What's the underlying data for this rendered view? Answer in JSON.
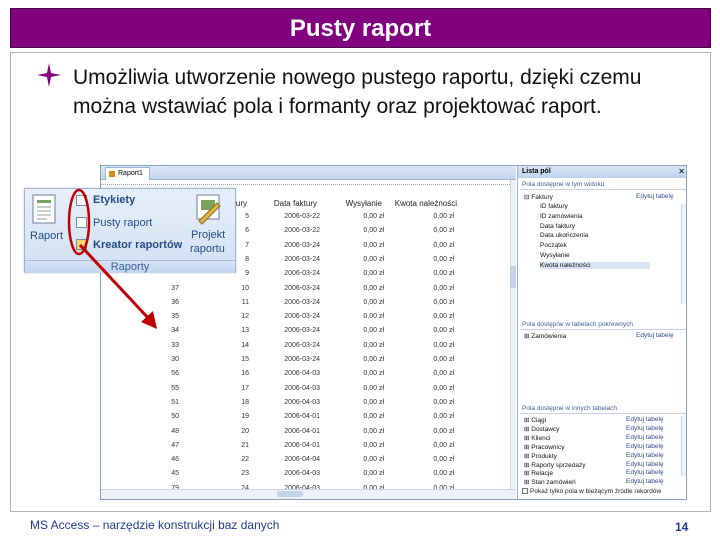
{
  "slide": {
    "title": "Pusty raport",
    "bullet": "Umożliwia utworzenie nowego pustego raportu, dzięki czemu można wstawiać pola i formanty oraz projektować raport.",
    "footer": "MS Access – narzędzie konstrukcji baz danych",
    "page_number": "14",
    "colors": {
      "title_bg": "#800080",
      "bullet_star": "#800080",
      "arrow": "#c00000",
      "footer_text": "#1f3a93"
    }
  },
  "report_view": {
    "tab_label": "Raport1",
    "columns": [
      {
        "key": "c1",
        "label": ""
      },
      {
        "key": "c2",
        "label": "ury"
      },
      {
        "key": "data_faktury",
        "label": "Data faktury"
      },
      {
        "key": "wysylanie",
        "label": "Wysyłanie"
      },
      {
        "key": "kwota",
        "label": "Kwota należności"
      }
    ],
    "rows": [
      [
        "",
        "5",
        "2006-03-22",
        "0,00 zł",
        "0,00 zł"
      ],
      [
        "",
        "6",
        "2006-03-22",
        "0,00 zł",
        "0,00 zł"
      ],
      [
        "",
        "7",
        "2006-03-24",
        "0,00 zł",
        "0,00 zł"
      ],
      [
        "",
        "8",
        "2006-03-24",
        "0,00 zł",
        "0,00 zł"
      ],
      [
        "",
        "9",
        "2006-03-24",
        "0,00 zł",
        "0,00 zł"
      ],
      [
        "37",
        "10",
        "2006-03-24",
        "0,00 zł",
        "0,00 zł"
      ],
      [
        "36",
        "11",
        "2006-03-24",
        "0,00 zł",
        "0,00 zł"
      ],
      [
        "35",
        "12",
        "2006-03-24",
        "0,00 zł",
        "0,00 zł"
      ],
      [
        "34",
        "13",
        "2006-03-24",
        "0,00 zł",
        "0,00 zł"
      ],
      [
        "33",
        "14",
        "2006-03-24",
        "0,00 zł",
        "0,00 zł"
      ],
      [
        "30",
        "15",
        "2006-03-24",
        "0,00 zł",
        "0,00 zł"
      ],
      [
        "56",
        "16",
        "2006-04-03",
        "0,00 zł",
        "0,00 zł"
      ],
      [
        "55",
        "17",
        "2006-04-03",
        "0,00 zł",
        "0,00 zł"
      ],
      [
        "51",
        "18",
        "2006-04-03",
        "0,00 zł",
        "0,00 zł"
      ],
      [
        "50",
        "19",
        "2006-04-01",
        "0,00 zł",
        "0,00 zł"
      ],
      [
        "48",
        "20",
        "2006-04-01",
        "0,00 zł",
        "0,00 zł"
      ],
      [
        "47",
        "21",
        "2006-04-01",
        "0,00 zł",
        "0,00 zł"
      ],
      [
        "46",
        "22",
        "2006-04-04",
        "0,00 zł",
        "0,00 zł"
      ],
      [
        "45",
        "23",
        "2006-04-03",
        "0,00 zł",
        "0,00 zł"
      ],
      [
        "79",
        "24",
        "2006-04-03",
        "0,00 zł",
        "0,00 zł"
      ]
    ]
  },
  "field_list": {
    "title": "Lista pól",
    "section_current": "Pola dostępne w tym widoku",
    "edit_table": "Edytuj tabelę",
    "faktury_table": "Faktury",
    "faktury_fields": [
      "ID faktury",
      "ID zamówienia",
      "Data faktury",
      "Data ukończenia",
      "Początek",
      "Wysyłanie",
      "Kwota należności"
    ],
    "section_related": "Pola dostępne w tabelach pokrewnych",
    "related_tables": [
      "Zamówienia"
    ],
    "section_other": "Pola dostępne w innych tabelach",
    "other_tables": [
      "Ciągi",
      "Dostawcy",
      "Klienci",
      "Pracownicy",
      "Produkty",
      "Raporty sprzedaży",
      "Relacje",
      "Stan zamówień"
    ],
    "footer_checkbox": "Pokaż tylko pola w bieżącym źródle rekordów"
  },
  "ribbon": {
    "raport_label": "Raport",
    "etykiety_label": "Etykiety",
    "pusty_raport_label": "Pusty raport",
    "kreator_label": "Kreator raportów",
    "projekt_label_1": "Projekt",
    "projekt_label_2": "raportu",
    "group_label": "Raporty"
  }
}
